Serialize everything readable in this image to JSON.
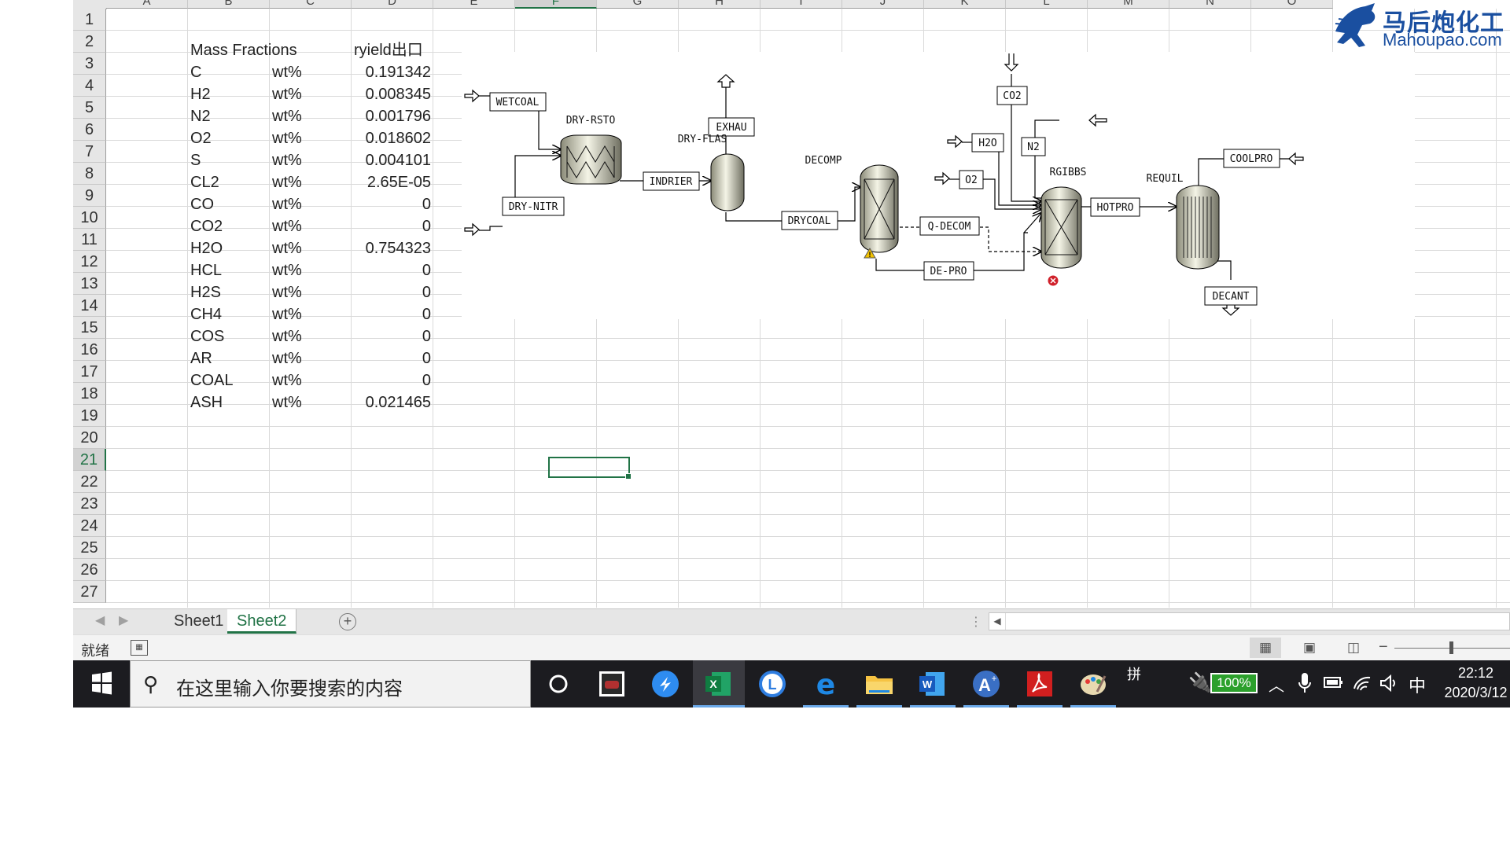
{
  "excel": {
    "columns": [
      "A",
      "B",
      "C",
      "D",
      "E",
      "F",
      "G",
      "H",
      "I",
      "J",
      "K",
      "L",
      "M",
      "N",
      "O"
    ],
    "selected_column": "F",
    "rows": [
      "1",
      "2",
      "3",
      "4",
      "5",
      "6",
      "7",
      "8",
      "9",
      "10",
      "11",
      "12",
      "13",
      "14",
      "15",
      "16",
      "17",
      "18",
      "19",
      "20",
      "21",
      "22",
      "23",
      "24",
      "25",
      "26",
      "27"
    ],
    "selected_row": "21",
    "table": {
      "header": {
        "label": "Mass Fractions",
        "value": "ryield出口"
      },
      "rows": [
        {
          "component": "C",
          "unit": "wt%",
          "value": "0.191342"
        },
        {
          "component": "H2",
          "unit": "wt%",
          "value": "0.008345"
        },
        {
          "component": "N2",
          "unit": "wt%",
          "value": "0.001796"
        },
        {
          "component": "O2",
          "unit": "wt%",
          "value": "0.018602"
        },
        {
          "component": "S",
          "unit": "wt%",
          "value": "0.004101"
        },
        {
          "component": "CL2",
          "unit": "wt%",
          "value": "2.65E-05"
        },
        {
          "component": "CO",
          "unit": "wt%",
          "value": "0"
        },
        {
          "component": "CO2",
          "unit": "wt%",
          "value": "0"
        },
        {
          "component": "H2O",
          "unit": "wt%",
          "value": "0.754323"
        },
        {
          "component": "HCL",
          "unit": "wt%",
          "value": "0"
        },
        {
          "component": "H2S",
          "unit": "wt%",
          "value": "0"
        },
        {
          "component": "CH4",
          "unit": "wt%",
          "value": "0"
        },
        {
          "component": "COS",
          "unit": "wt%",
          "value": "0"
        },
        {
          "component": "AR",
          "unit": "wt%",
          "value": "0"
        },
        {
          "component": "COAL",
          "unit": "wt%",
          "value": "0"
        },
        {
          "component": "ASH",
          "unit": "wt%",
          "value": "0.021465"
        }
      ]
    },
    "sheet_tabs": [
      "Sheet1",
      "Sheet2"
    ],
    "active_sheet": "Sheet2",
    "status_text": "就绪"
  },
  "flowsheet": {
    "blocks": {
      "dry_rsto": "DRY-RSTO",
      "dry_flas": "DRY-FLAS",
      "decomp": "DECOMP",
      "rgibbs": "RGIBBS",
      "requil": "REQUIL"
    },
    "streams": {
      "wetcoal": "WETCOAL",
      "dry_nitr": "DRY-NITR",
      "indrier": "INDRIER",
      "exhau": "EXHAU",
      "drycoal": "DRYCOAL",
      "q_decom": "Q-DECOM",
      "de_pro": "DE-PRO",
      "co2": "CO2",
      "h2o": "H2O",
      "o2": "O2",
      "n2": "N2",
      "hotpro": "HOTPRO",
      "coolpro": "COOLPRO",
      "decant": "DECANT"
    },
    "colors": {
      "block_fill": "#d8d8c8",
      "line": "#000000",
      "warning": "#f2c200",
      "error": "#d0202a"
    }
  },
  "watermark": {
    "chinese": "马后炮化工",
    "site": "Mahoupao.com"
  },
  "taskbar": {
    "search_placeholder": "在这里输入你要搜索的内容",
    "apps": [
      "cortana-icon",
      "media-app-icon",
      "feishu-icon",
      "excel-icon",
      "l-app-icon",
      "edge-icon",
      "file-explorer-icon",
      "word-icon",
      "aspen-plus-icon",
      "acrobat-icon",
      "paint-icon"
    ],
    "ime_pin": "拼",
    "battery": "100%",
    "ime_lang": "中",
    "time": "22:12",
    "date": "2020/3/12"
  }
}
